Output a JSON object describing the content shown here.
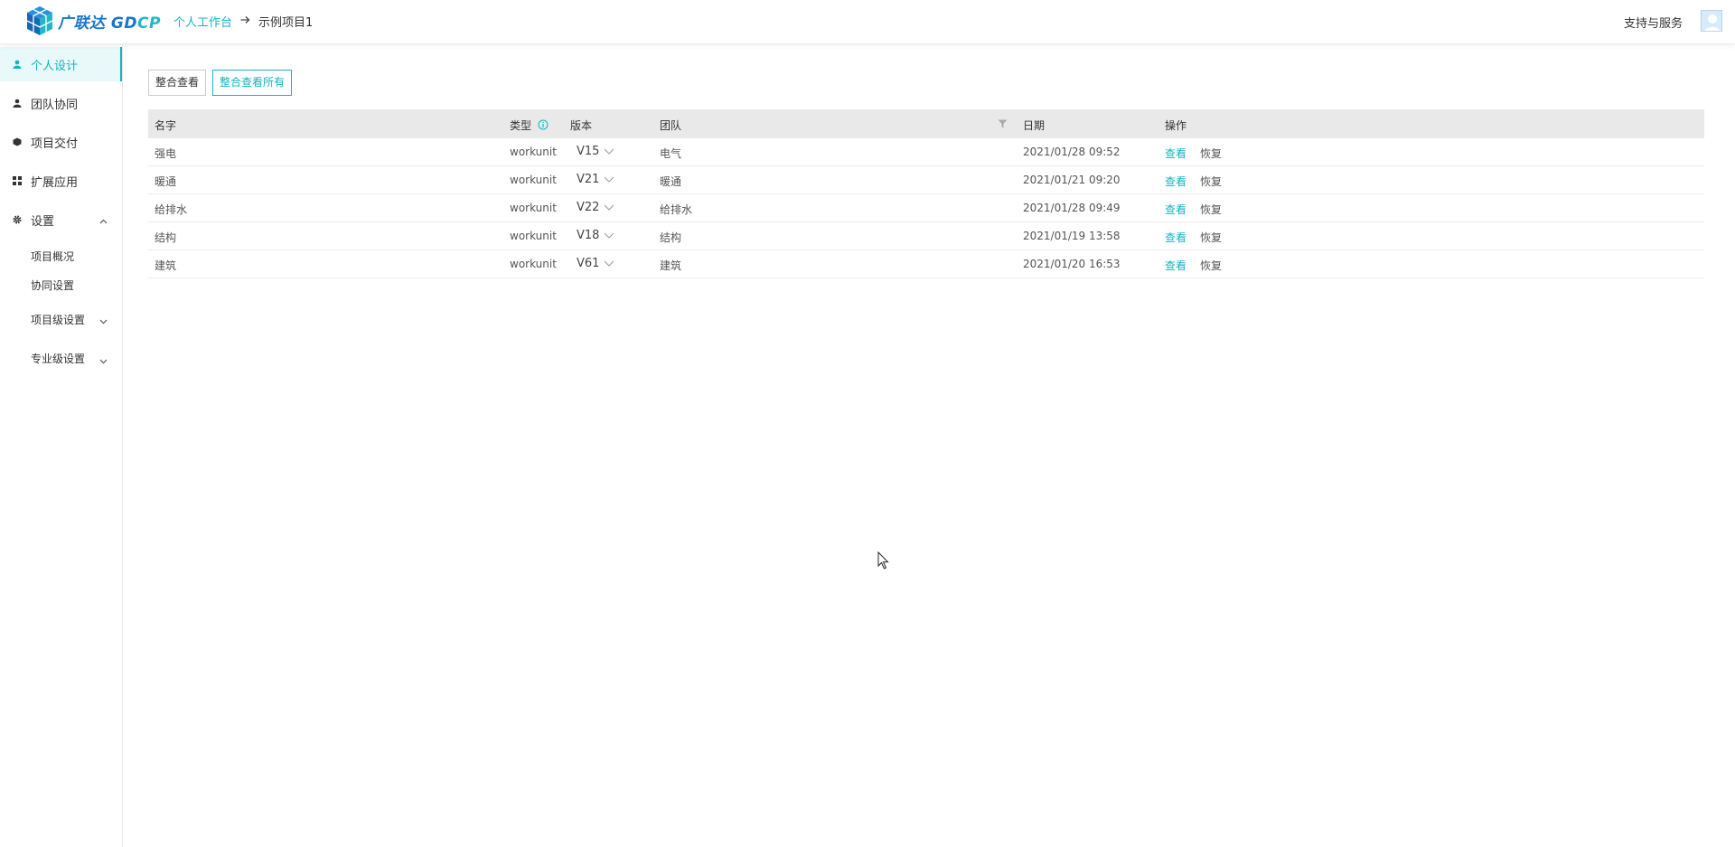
{
  "header": {
    "logo_text": "广联达 GD",
    "logo_text_accent": "CP",
    "breadcrumb": [
      "个人工作台",
      "示例项目1"
    ],
    "support": "支持与服务"
  },
  "sidebar": {
    "items": [
      {
        "label": "个人设计",
        "icon": "user-icon"
      },
      {
        "label": "团队协同",
        "icon": "team-icon"
      },
      {
        "label": "项目交付",
        "icon": "delivery-icon"
      },
      {
        "label": "扩展应用",
        "icon": "grid-icon"
      },
      {
        "label": "设置",
        "icon": "gear-icon"
      }
    ],
    "sub_items": [
      "项目概况",
      "协同设置",
      "项目级设置",
      "专业级设置"
    ]
  },
  "toolbar": {
    "merge_view": "整合查看",
    "merge_view_all": "整合查看所有"
  },
  "table": {
    "headers": {
      "name": "名字",
      "type": "类型",
      "version": "版本",
      "team": "团队",
      "date": "日期",
      "actions": "操作"
    },
    "rows": [
      {
        "name": "强电",
        "type": "workunit",
        "version": "V15",
        "team": "电气",
        "date": "2021/01/28 09:52",
        "view": "查看",
        "restore": "恢复"
      },
      {
        "name": "暖通",
        "type": "workunit",
        "version": "V21",
        "team": "暖通",
        "date": "2021/01/21 09:20",
        "view": "查看",
        "restore": "恢复"
      },
      {
        "name": "给排水",
        "type": "workunit",
        "version": "V22",
        "team": "给排水",
        "date": "2021/01/28 09:49",
        "view": "查看",
        "restore": "恢复"
      },
      {
        "name": "结构",
        "type": "workunit",
        "version": "V18",
        "team": "结构",
        "date": "2021/01/19 13:58",
        "view": "查看",
        "restore": "恢复"
      },
      {
        "name": "建筑",
        "type": "workunit",
        "version": "V61",
        "team": "建筑",
        "date": "2021/01/20 16:53",
        "view": "查看",
        "restore": "恢复"
      }
    ]
  },
  "colors": {
    "accent": "#13b5c1",
    "brand": "#1976c8",
    "header_bg": "#e9e9e9"
  }
}
